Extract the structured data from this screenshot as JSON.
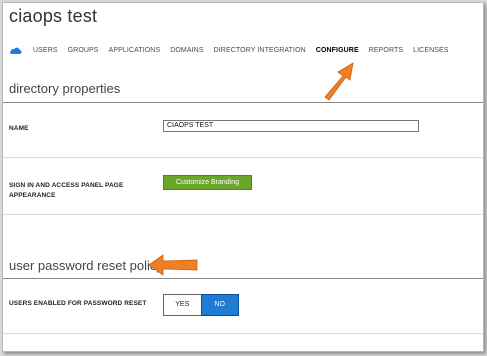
{
  "header": {
    "title": "ciaops test"
  },
  "nav": {
    "tabs": [
      {
        "label": "USERS"
      },
      {
        "label": "GROUPS"
      },
      {
        "label": "APPLICATIONS"
      },
      {
        "label": "DOMAINS"
      },
      {
        "label": "DIRECTORY INTEGRATION"
      },
      {
        "label": "CONFIGURE"
      },
      {
        "label": "REPORTS"
      },
      {
        "label": "LICENSES"
      }
    ],
    "active_tab": "CONFIGURE"
  },
  "directory_properties": {
    "heading": "directory properties",
    "name_label": "NAME",
    "name_value": "CIAOPS TEST",
    "branding_label_line1": "SIGN IN AND ACCESS PANEL PAGE",
    "branding_label_line2": "APPEARANCE",
    "branding_button": "Customize Branding"
  },
  "password_reset": {
    "heading": "user password reset policy",
    "enabled_label": "USERS ENABLED FOR PASSWORD RESET",
    "option_yes": "YES",
    "option_no": "NO",
    "selected": "NO"
  },
  "colors": {
    "accent_blue": "#1f7bd4",
    "button_green": "#6aa62a",
    "annotation_orange": "#f07f24"
  },
  "icons": {
    "nav_home": "cloud-icon",
    "annotation": "arrow-icon"
  }
}
